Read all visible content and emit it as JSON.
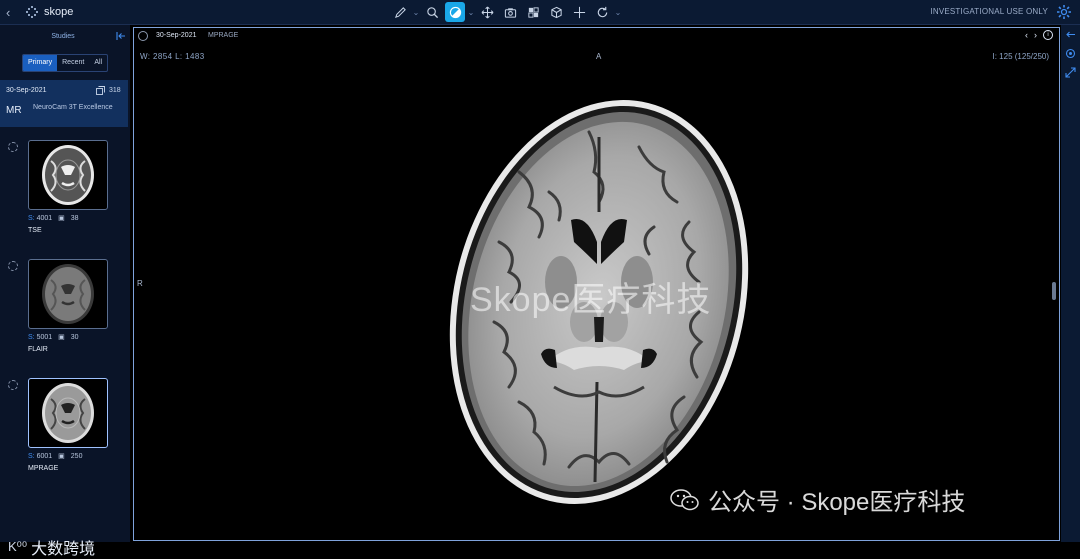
{
  "app": {
    "name": "skope",
    "notice": "INVESTIGATIONAL USE ONLY"
  },
  "toolbar": {
    "tools": [
      "pencil-icon",
      "zoom-icon",
      "contrast-icon",
      "pan-icon",
      "camera-icon",
      "layout-icon",
      "cube-icon",
      "crosshair-icon",
      "reset-icon"
    ],
    "active_tool": "contrast-icon",
    "accent": "#1aa7e8"
  },
  "sidebar": {
    "title": "Studies",
    "filters": [
      "Primary",
      "Recent",
      "All"
    ],
    "active_filter": "Primary",
    "study": {
      "date": "30-Sep-2021",
      "image_count": "318",
      "modality": "MR",
      "description": "NeuroCam 3T Excellence"
    },
    "series": [
      {
        "number_label": "S:",
        "number": "4001",
        "images": "38",
        "name": "TSE"
      },
      {
        "number_label": "S:",
        "number": "5001",
        "images": "30",
        "name": "FLAIR"
      },
      {
        "number_label": "S:",
        "number": "6001",
        "images": "250",
        "name": "MPRAGE"
      }
    ]
  },
  "viewport": {
    "date": "30-Sep-2021",
    "series": "MPRAGE",
    "window": "W: 2854  L: 1483",
    "image_index": "I: 125 (125/250)",
    "orientation_top": "A",
    "orientation_left": "R",
    "watermark": "Skope医疗科技"
  },
  "overlay": {
    "wechat_text": "公众号 · Skope医疗科技",
    "corner_text": "大数跨境"
  }
}
